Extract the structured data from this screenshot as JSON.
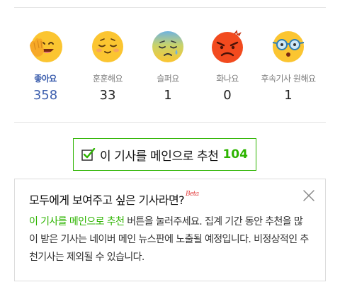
{
  "reactions": [
    {
      "id": "like",
      "label": "좋아요",
      "count": "358",
      "icon": "smiling-face-waving-icon",
      "active": true
    },
    {
      "id": "warm",
      "label": "훈훈해요",
      "count": "33",
      "icon": "content-smiling-face-icon",
      "active": false
    },
    {
      "id": "sad",
      "label": "슬퍼요",
      "count": "1",
      "icon": "crying-face-icon",
      "active": false
    },
    {
      "id": "angry",
      "label": "화나요",
      "count": "0",
      "icon": "angry-face-icon",
      "active": false
    },
    {
      "id": "followup",
      "label": "후속기사 원해요",
      "count": "1",
      "icon": "glasses-face-icon",
      "active": false
    }
  ],
  "recommend": {
    "label": "이 기사를 메인으로 추천",
    "count": "104",
    "icon": "checkbox-icon"
  },
  "info": {
    "title": "모두에게 보여주고 싶은 기사라면?",
    "beta": "Beta",
    "highlight": "이 기사를 메인으로 추천",
    "body": " 버튼을 눌러주세요. 집계 기간 동안 추천을 많이 받은 기사는 네이버 메인 뉴스판에 노출될 예정입니다. 비정상적인 추천기사는 제외될 수 있습니다.",
    "close_icon": "close-icon"
  },
  "colors": {
    "active_blue": "#3d5fae",
    "accent_green": "#2db400",
    "beta_red": "#e23e3e",
    "emoji_yellow": "#fbc531",
    "emoji_red": "#f24a1e"
  }
}
